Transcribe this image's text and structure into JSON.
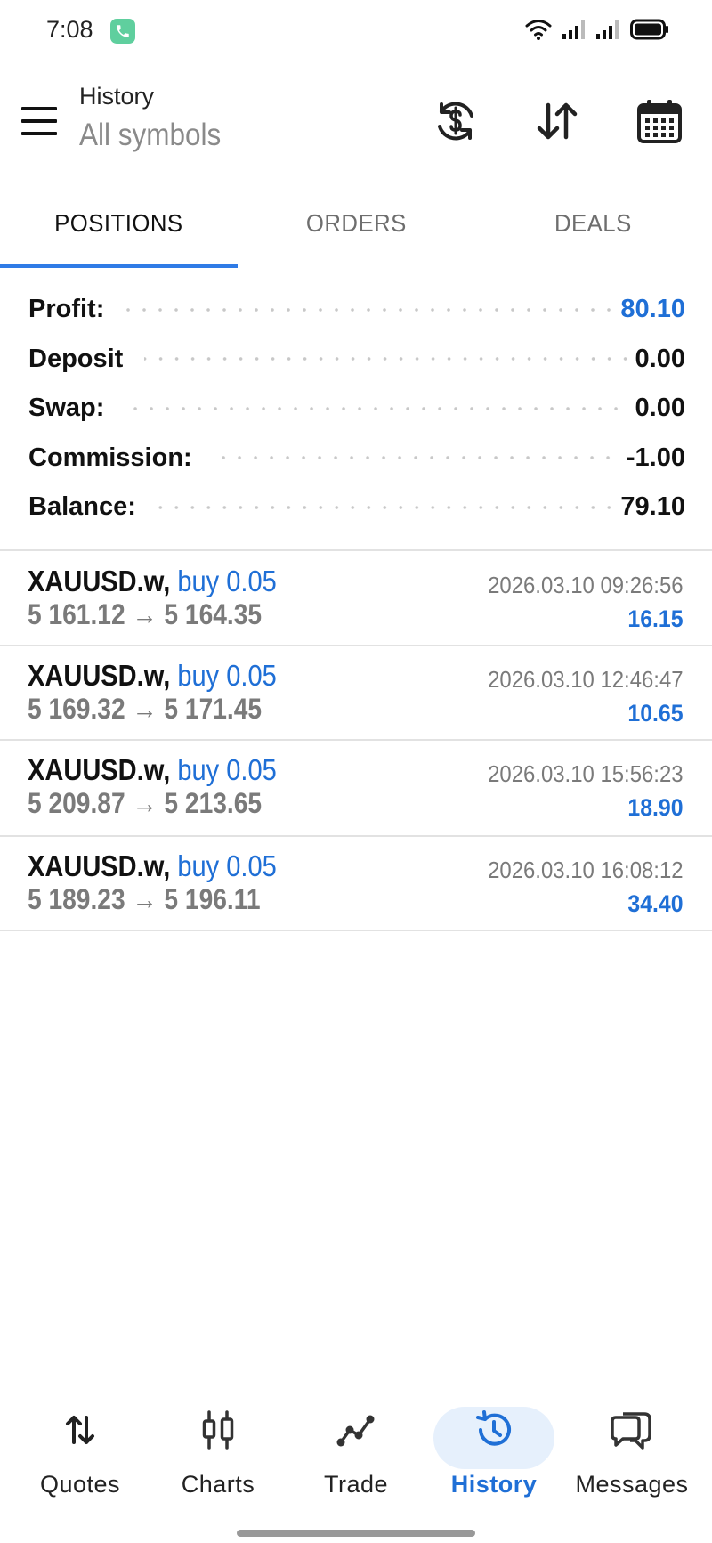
{
  "status_bar": {
    "time": "7:08",
    "icons": [
      "call-icon",
      "wifi-icon",
      "signal-icon",
      "signal-icon",
      "battery-icon"
    ]
  },
  "header": {
    "title": "History",
    "subtitle": "All symbols",
    "actions": [
      "currency-refresh-icon",
      "sort-icon",
      "calendar-icon"
    ]
  },
  "tabs": [
    {
      "label": "POSITIONS",
      "active": true
    },
    {
      "label": "ORDERS",
      "active": false
    },
    {
      "label": "DEALS",
      "active": false
    }
  ],
  "summary": [
    {
      "label": "Profit:",
      "value": "80.10",
      "highlight": true
    },
    {
      "label": "Deposit",
      "value": "0.00",
      "highlight": false
    },
    {
      "label": "Swap:",
      "value": "0.00",
      "highlight": false
    },
    {
      "label": "Commission:",
      "value": "-1.00",
      "highlight": false
    },
    {
      "label": "Balance:",
      "value": "79.10",
      "highlight": false
    }
  ],
  "positions": [
    {
      "symbol": "XAUUSD.w,",
      "side": "buy 0.05",
      "open": "5 161.12",
      "close": "5 164.35",
      "time": "2026.03.10 09:26:56",
      "profit": "16.15"
    },
    {
      "symbol": "XAUUSD.w,",
      "side": "buy 0.05",
      "open": "5 169.32",
      "close": "5 171.45",
      "time": "2026.03.10 12:46:47",
      "profit": "10.65"
    },
    {
      "symbol": "XAUUSD.w,",
      "side": "buy 0.05",
      "open": "5 209.87",
      "close": "5 213.65",
      "time": "2026.03.10 15:56:23",
      "profit": "18.90"
    },
    {
      "symbol": "XAUUSD.w,",
      "side": "buy 0.05",
      "open": "5 189.23",
      "close": "5 196.11",
      "time": "2026.03.10 16:08:12",
      "profit": "34.40"
    }
  ],
  "arrow": "→",
  "bottom_nav": [
    {
      "label": "Quotes",
      "icon": "quotes-icon",
      "active": false
    },
    {
      "label": "Charts",
      "icon": "charts-icon",
      "active": false
    },
    {
      "label": "Trade",
      "icon": "trade-icon",
      "active": false
    },
    {
      "label": "History",
      "icon": "history-icon",
      "active": true
    },
    {
      "label": "Messages",
      "icon": "messages-icon",
      "active": false
    }
  ],
  "colors": {
    "accent": "#1f6fd6",
    "tab_indicator": "#2f7be6",
    "nav_active_bg": "#e6f0fc",
    "call_badge": "#5fcf9e"
  }
}
